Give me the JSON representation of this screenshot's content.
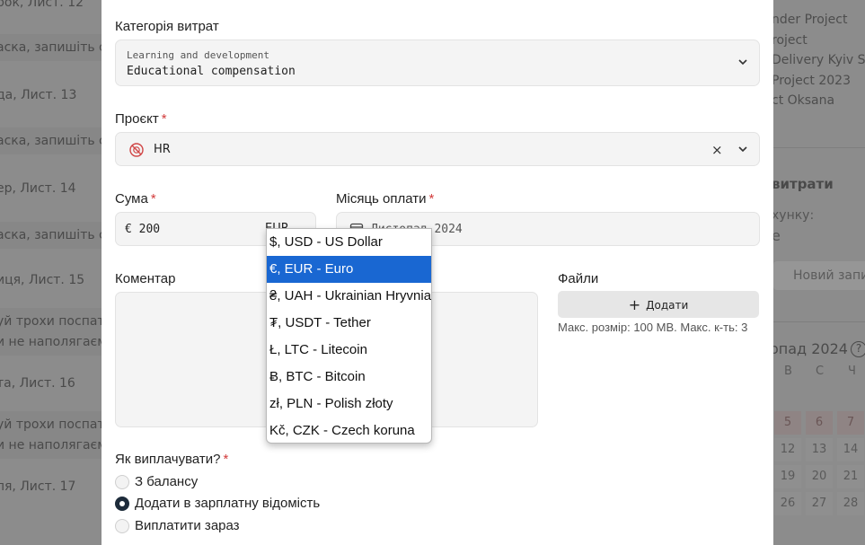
{
  "background_left": {
    "rows": [
      "рок, Лист. 12",
      "аска, запишіть с",
      "да, Лист. 13",
      "аска, запишіть с",
      "ер, Лист. 14",
      "аска, запишіть с",
      "иця, Лист. 15",
      "уй трохи поспат",
      "и не наполягаєм",
      "та, Лист. 16",
      "уй трохи поспат",
      "и не наполягаєм",
      "ля, Лист. 17"
    ]
  },
  "background_right": {
    "projects": [
      "nder Project",
      "roject",
      "Delivery Kyiv SE",
      "Project 2023",
      "ct Oksana"
    ],
    "expenses_title": "витрати",
    "account_label": "хунку:",
    "account_value": "е",
    "new_button": "Новий запи",
    "calendar_title": "опад 2024",
    "help_icon_text": "?",
    "weekdays": [
      "В",
      "С",
      "Ч"
    ],
    "days": [
      [
        "5",
        "6",
        "7"
      ],
      [
        "12",
        "13",
        "14"
      ],
      [
        "19",
        "20",
        "21"
      ],
      [
        "26",
        "27",
        "28"
      ]
    ]
  },
  "form": {
    "category": {
      "label": "Категорія витрат",
      "group": "Learning and development",
      "value": "Educational compensation"
    },
    "project": {
      "label": "Проєкт",
      "required_mark": "*",
      "value": "HR",
      "clear_icon": "×"
    },
    "amount": {
      "label": "Сума",
      "required_mark": "*",
      "value": "€ 200",
      "currency": "EUR"
    },
    "payment_month": {
      "label": "Місяць оплати",
      "required_mark": "*",
      "value": "Листопад 2024"
    },
    "comment": {
      "label": "Коментар",
      "value": ""
    },
    "files": {
      "label": "Файли",
      "upload_button": "Додати",
      "hint": "Макс. розмір: 100 MB. Макс. к-ть: 3"
    },
    "payout": {
      "label": "Як виплачувати?",
      "required_mark": "*",
      "options": [
        {
          "label": "З балансу",
          "checked": false
        },
        {
          "label": "Додати в зарплатну відомість",
          "checked": true
        },
        {
          "label": "Виплатити зараз",
          "checked": false
        }
      ]
    }
  },
  "currency_dropdown": {
    "selected": "€, EUR - Euro",
    "options": [
      "$, USD - US Dollar",
      "€, EUR - Euro",
      "₴, UAH - Ukrainian Hryvnia",
      "₮, USDT - Tether",
      "Ł, LTC - Litecoin",
      "Ƀ, BTC - Bitcoin",
      "zł, PLN - Polish złoty",
      "Kč, CZK - Czech koruna"
    ]
  },
  "colors": {
    "selected_option": "#1967d2",
    "required_mark": "#d23b3b",
    "radio_checked": "#1d2b3a"
  }
}
